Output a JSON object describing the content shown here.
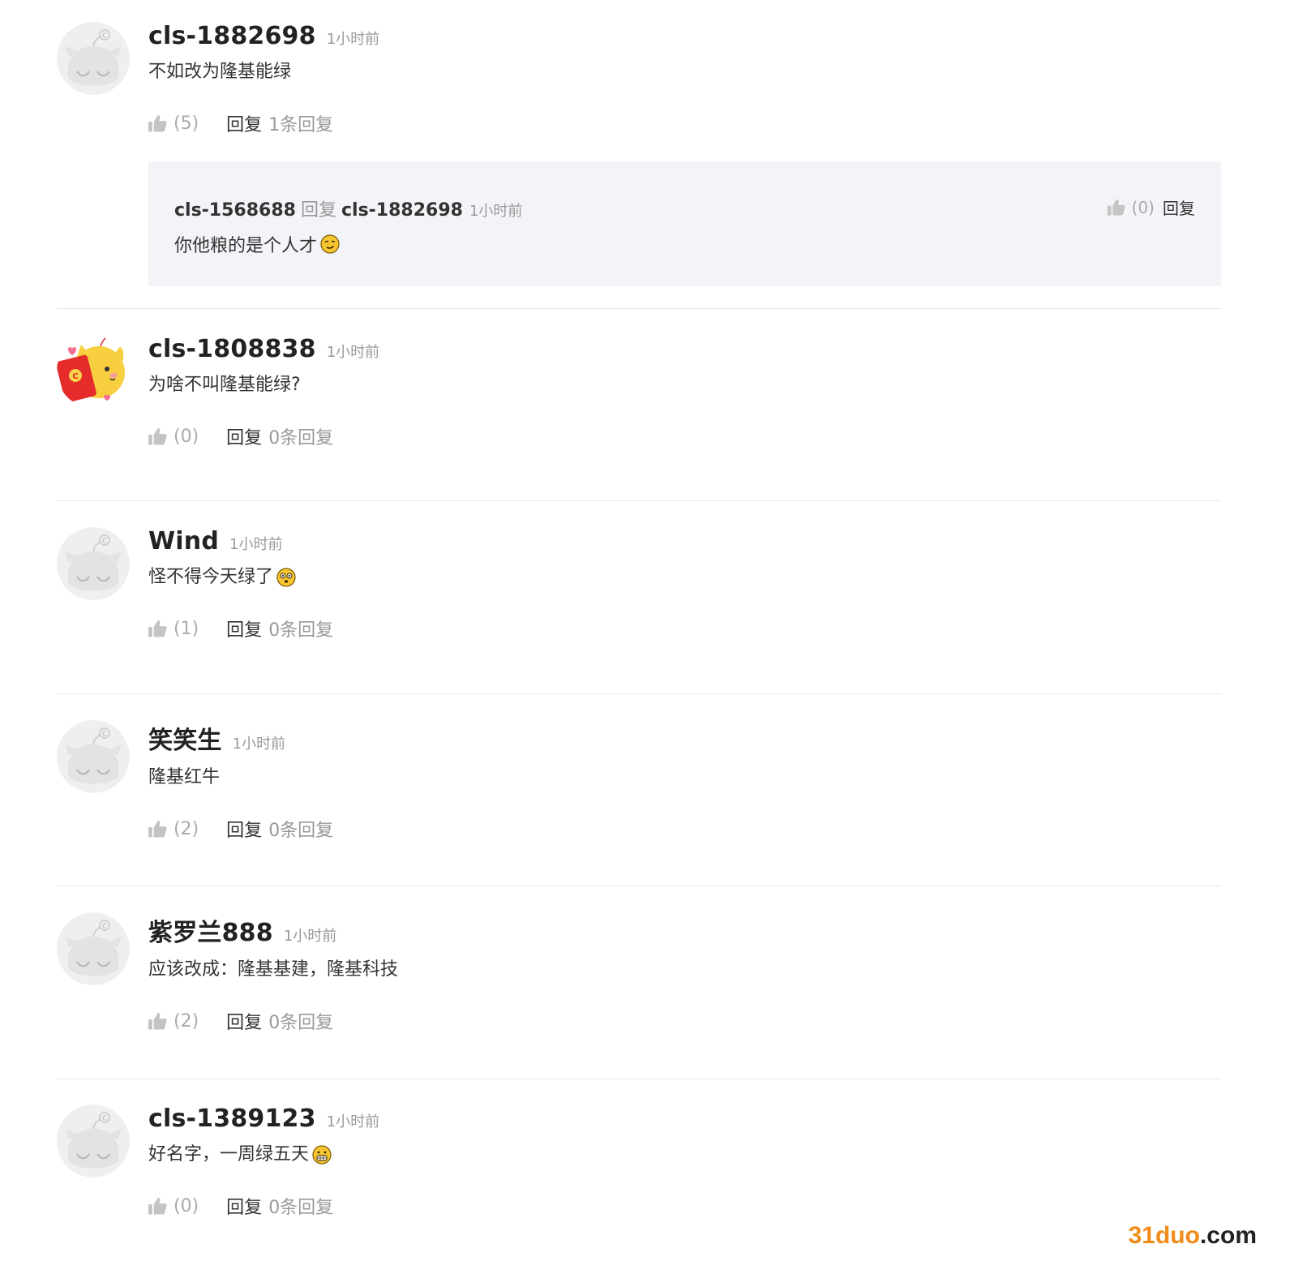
{
  "comments": [
    {
      "user": "cls-1882698",
      "time": "1小时前",
      "text": "不如改为隆基能绿",
      "likes": "(5)",
      "reply_label": "回复",
      "reply_count": "1条回复",
      "avatar": "default-cat",
      "emoji": "",
      "replies": [
        {
          "user": "cls-1568688",
          "reply_word": "回复",
          "target": "cls-1882698",
          "time": "1小时前",
          "text": "你他粮的是个人才",
          "likes": "(0)",
          "reply_label": "回复",
          "emoji": "smirk"
        }
      ]
    },
    {
      "user": "cls-1808838",
      "time": "1小时前",
      "text": "为啥不叫隆基能绿?",
      "likes": "(0)",
      "reply_label": "回复",
      "reply_count": "0条回复",
      "avatar": "yellow-cat-red-envelope",
      "emoji": ""
    },
    {
      "user": "Wind",
      "time": "1小时前",
      "text": "怪不得今天绿了",
      "likes": "(1)",
      "reply_label": "回复",
      "reply_count": "0条回复",
      "avatar": "default-cat",
      "emoji": "flushed"
    },
    {
      "user": "笑笑生",
      "time": "1小时前",
      "text": "隆基红牛",
      "likes": "(2)",
      "reply_label": "回复",
      "reply_count": "0条回复",
      "avatar": "default-cat",
      "emoji": ""
    },
    {
      "user": "紫罗兰888",
      "time": "1小时前",
      "text": "应该改成：隆基基建，隆基科技",
      "likes": "(2)",
      "reply_label": "回复",
      "reply_count": "0条回复",
      "avatar": "default-cat",
      "emoji": ""
    },
    {
      "user": "cls-1389123",
      "time": "1小时前",
      "text": "好名字，一周绿五天 ",
      "likes": "(0)",
      "reply_label": "回复",
      "reply_count": "0条回复",
      "avatar": "default-cat",
      "emoji": "grimace"
    }
  ],
  "watermark": {
    "part1": "31duo",
    "part2": ".com",
    "color1": "#f08c1a",
    "color2": "#222222"
  },
  "colors": {
    "username": "#222222",
    "meta": "#999999",
    "nested_bg": "#f3f4f8",
    "divider": "#e8e8e8"
  }
}
